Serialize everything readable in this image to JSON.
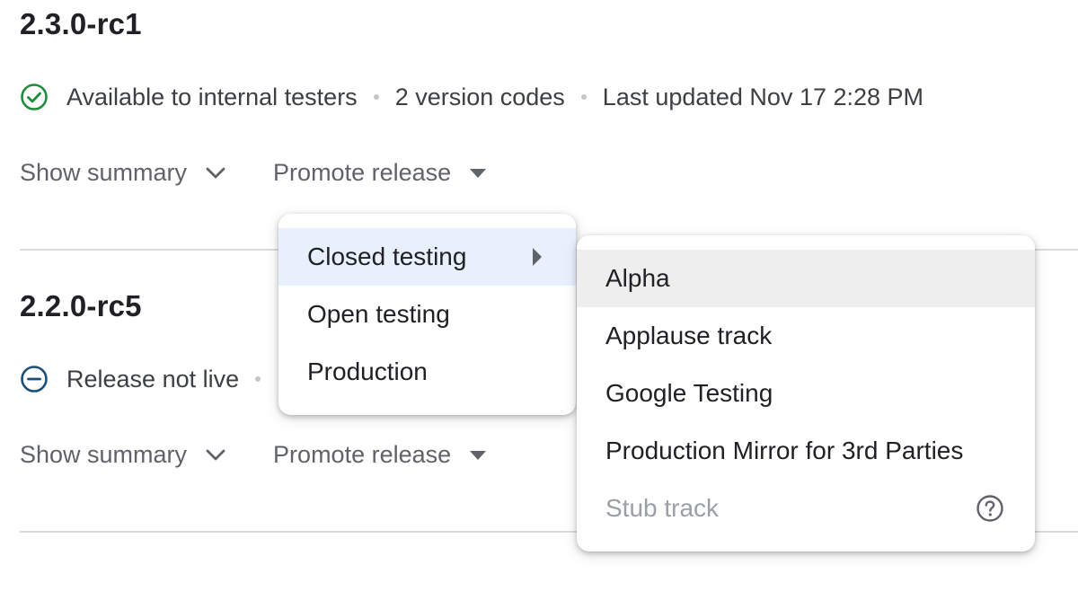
{
  "releases": [
    {
      "version": "2.3.0-rc1",
      "status": "Available to internal testers",
      "status_icon": "check-circle-icon",
      "version_codes": "2 version codes",
      "last_updated": "Last updated Nov 17 2:28 PM",
      "show_summary_label": "Show summary",
      "promote_label": "Promote release"
    },
    {
      "version": "2.2.0-rc5",
      "status": "Release not live",
      "status_icon": "minus-circle-icon",
      "show_summary_label": "Show summary",
      "promote_label": "Promote release"
    }
  ],
  "promote_menu": {
    "items": [
      {
        "label": "Closed testing",
        "has_submenu": true,
        "selected": true
      },
      {
        "label": "Open testing"
      },
      {
        "label": "Production"
      }
    ]
  },
  "closed_testing_submenu": {
    "items": [
      {
        "label": "Alpha",
        "highlighted": true
      },
      {
        "label": "Applause track"
      },
      {
        "label": "Google Testing"
      },
      {
        "label": "Production Mirror for 3rd Parties"
      },
      {
        "label": "Stub track",
        "disabled": true,
        "icon": "help-icon"
      }
    ]
  },
  "colors": {
    "success_green": "#1e8e3e",
    "not_live_blue": "#1a4f7a",
    "selected_bg": "#e8f0fe",
    "hover_bg": "#eeeeee",
    "disabled_text": "#9aa0a6"
  }
}
